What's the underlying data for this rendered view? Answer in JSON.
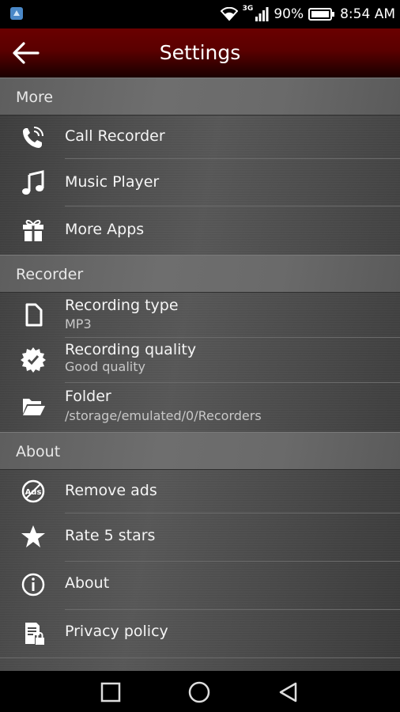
{
  "status_bar": {
    "network": "3G",
    "battery": "90%",
    "time": "8:54 AM"
  },
  "app_bar": {
    "title": "Settings"
  },
  "sections": {
    "more": {
      "header": "More",
      "items": [
        {
          "label": "Call Recorder",
          "icon": "phone-call-icon"
        },
        {
          "label": "Music Player",
          "icon": "music-note-icon"
        },
        {
          "label": "More Apps",
          "icon": "gift-icon"
        }
      ]
    },
    "recorder": {
      "header": "Recorder",
      "items": [
        {
          "label": "Recording type",
          "value": "MP3",
          "icon": "file-icon"
        },
        {
          "label": "Recording quality",
          "value": "Good quality",
          "icon": "quality-badge-icon"
        },
        {
          "label": "Folder",
          "value": "/storage/emulated/0/Recorders",
          "icon": "folder-open-icon"
        }
      ]
    },
    "about": {
      "header": "About",
      "items": [
        {
          "label": "Remove ads",
          "icon": "no-ads-icon"
        },
        {
          "label": "Rate 5 stars",
          "icon": "star-icon"
        },
        {
          "label": "About",
          "icon": "info-icon"
        },
        {
          "label": "Privacy policy",
          "icon": "privacy-document-icon"
        }
      ]
    }
  },
  "nav_bar": {
    "buttons": [
      "recent-apps",
      "home",
      "back"
    ]
  }
}
